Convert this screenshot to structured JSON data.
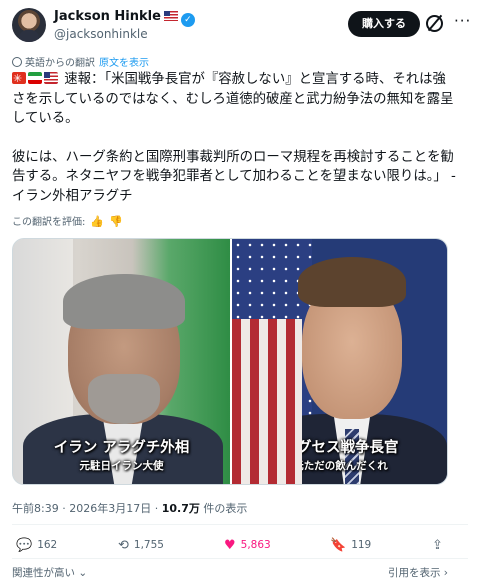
{
  "header": {
    "display_name": "Jackson Hinkle",
    "handle": "@jacksonhinkle",
    "buy_label": "購入する"
  },
  "translation": {
    "label": "英語からの翻訳",
    "show_original": "原文を表示"
  },
  "post": {
    "line1": "速報：「米国戦争長官が『容赦しない』と宣言する時、それは強",
    "line2": "さを示しているのではなく、むしろ道徳的破産と武力紛争法の無知を露呈",
    "line3": "している。",
    "line4": "彼には、ハーグ条約と国際刑事裁判所のローマ規程を再検討することを勧",
    "line5": "告する。ネタニヤフを戦争犯罪者として加わることを望まない限りは。」 -",
    "line6": "イラン外相アラグチ"
  },
  "rate": {
    "label": "この翻訳を評価:"
  },
  "media": {
    "left_caption": "イラン アラグチ外相",
    "left_subcaption": "元駐日イラン大使",
    "right_caption": "ヘグセス戦争長官",
    "right_subcaption": "元ただの飲んだくれ"
  },
  "meta": {
    "time": "午前8:39",
    "date": "2026年3月17日",
    "views": "10.7万",
    "views_suffix": "件の表示",
    "separator": "·"
  },
  "actions": {
    "replies": "162",
    "reposts": "1,755",
    "likes": "5,863",
    "bookmarks": "119"
  },
  "footer": {
    "sort_label": "関連性が高い",
    "chevron": "⌄",
    "reply_label": "引用を表示",
    "arrow": "›"
  },
  "colors": {
    "accent": "#1d9bf0",
    "like": "#f91880",
    "text": "#0f1419",
    "muted": "#536471"
  },
  "icons": [
    "avatar",
    "us-flag-icon",
    "verified-badge-icon",
    "grok-icon",
    "more-icon",
    "translate-icon",
    "thumbs-up-icon",
    "thumbs-down-icon",
    "reply-icon",
    "repost-icon",
    "like-icon",
    "bookmark-icon",
    "share-icon"
  ]
}
